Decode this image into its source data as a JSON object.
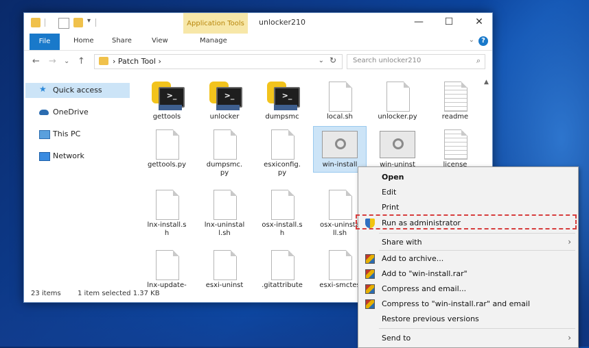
{
  "window": {
    "title": "unlocker210",
    "context_tab": "Application Tools",
    "minimize": "—",
    "maximize": "☐",
    "close": "✕"
  },
  "ribbon": {
    "tabs": [
      "File",
      "Home",
      "Share",
      "View",
      "Manage"
    ],
    "help": "?",
    "expand": "⌄"
  },
  "address": {
    "path": "› Patch Tool ›",
    "dropdown": "⌄",
    "refresh": "↻",
    "search_placeholder": "Search unlocker210",
    "search_icon": "⌕",
    "back": "←",
    "forward": "→",
    "recent": "⌄",
    "up": "↑"
  },
  "nav_pane": {
    "items": [
      {
        "label": "Quick access",
        "icon": "star-pin-icon",
        "selected": true
      },
      {
        "label": "OneDrive",
        "icon": "cloud-icon"
      },
      {
        "label": "This PC",
        "icon": "computer-icon"
      },
      {
        "label": "Network",
        "icon": "network-icon"
      }
    ]
  },
  "files": [
    {
      "name": "gettools",
      "icon": "python-icon"
    },
    {
      "name": "unlocker",
      "icon": "python-icon"
    },
    {
      "name": "dumpsmc",
      "icon": "python-icon"
    },
    {
      "name": "local.sh",
      "icon": "blank-doc-icon"
    },
    {
      "name": "unlocker.py",
      "icon": "blank-doc-icon"
    },
    {
      "name": "readme",
      "icon": "text-doc-icon"
    },
    {
      "name": "gettools.py",
      "icon": "blank-doc-icon"
    },
    {
      "name": "dumpsmc.\npy",
      "icon": "blank-doc-icon"
    },
    {
      "name": "esxiconfig.\npy",
      "icon": "blank-doc-icon"
    },
    {
      "name": "win-install",
      "icon": "settings-file-icon",
      "selected": true
    },
    {
      "name": "win-uninst",
      "icon": "settings-file-icon"
    },
    {
      "name": "license",
      "icon": "text-doc-icon"
    },
    {
      "name": "lnx-install.s\nh",
      "icon": "blank-doc-icon"
    },
    {
      "name": "lnx-uninstal\nl.sh",
      "icon": "blank-doc-icon"
    },
    {
      "name": "osx-install.s\nh",
      "icon": "blank-doc-icon"
    },
    {
      "name": "osx-uninsta\nll.sh",
      "icon": "blank-doc-icon"
    },
    {
      "name": "lnx-update-",
      "icon": "blank-doc-icon"
    },
    {
      "name": "esxi-uninst",
      "icon": "blank-doc-icon"
    },
    {
      "name": ".gitattribute",
      "icon": "blank-doc-icon"
    },
    {
      "name": "esxi-smctes",
      "icon": "blank-doc-icon"
    }
  ],
  "status": {
    "items": "23 items",
    "selection": "1 item selected  1.37 KB"
  },
  "context_menu": {
    "items": [
      {
        "label": "Open",
        "bold": true
      },
      {
        "label": "Edit"
      },
      {
        "label": "Print"
      },
      {
        "label": "Run as administrator",
        "icon": "uac-shield-icon",
        "highlighted": true
      },
      {
        "label": "Share with",
        "submenu": true
      },
      {
        "label": "Add to archive...",
        "icon": "winrar-icon"
      },
      {
        "label": "Add to \"win-install.rar\"",
        "icon": "winrar-icon"
      },
      {
        "label": "Compress and email...",
        "icon": "winrar-icon"
      },
      {
        "label": "Compress to \"win-install.rar\" and email",
        "icon": "winrar-icon"
      },
      {
        "label": "Restore previous versions"
      },
      {
        "label": "Send to",
        "submenu": true
      }
    ],
    "submenu_arrow": "›"
  },
  "colors": {
    "accent": "#1979ca",
    "highlight_border": "#d63b3b",
    "selection": "#cce4f7",
    "context_tab": "#f7e7a8"
  }
}
